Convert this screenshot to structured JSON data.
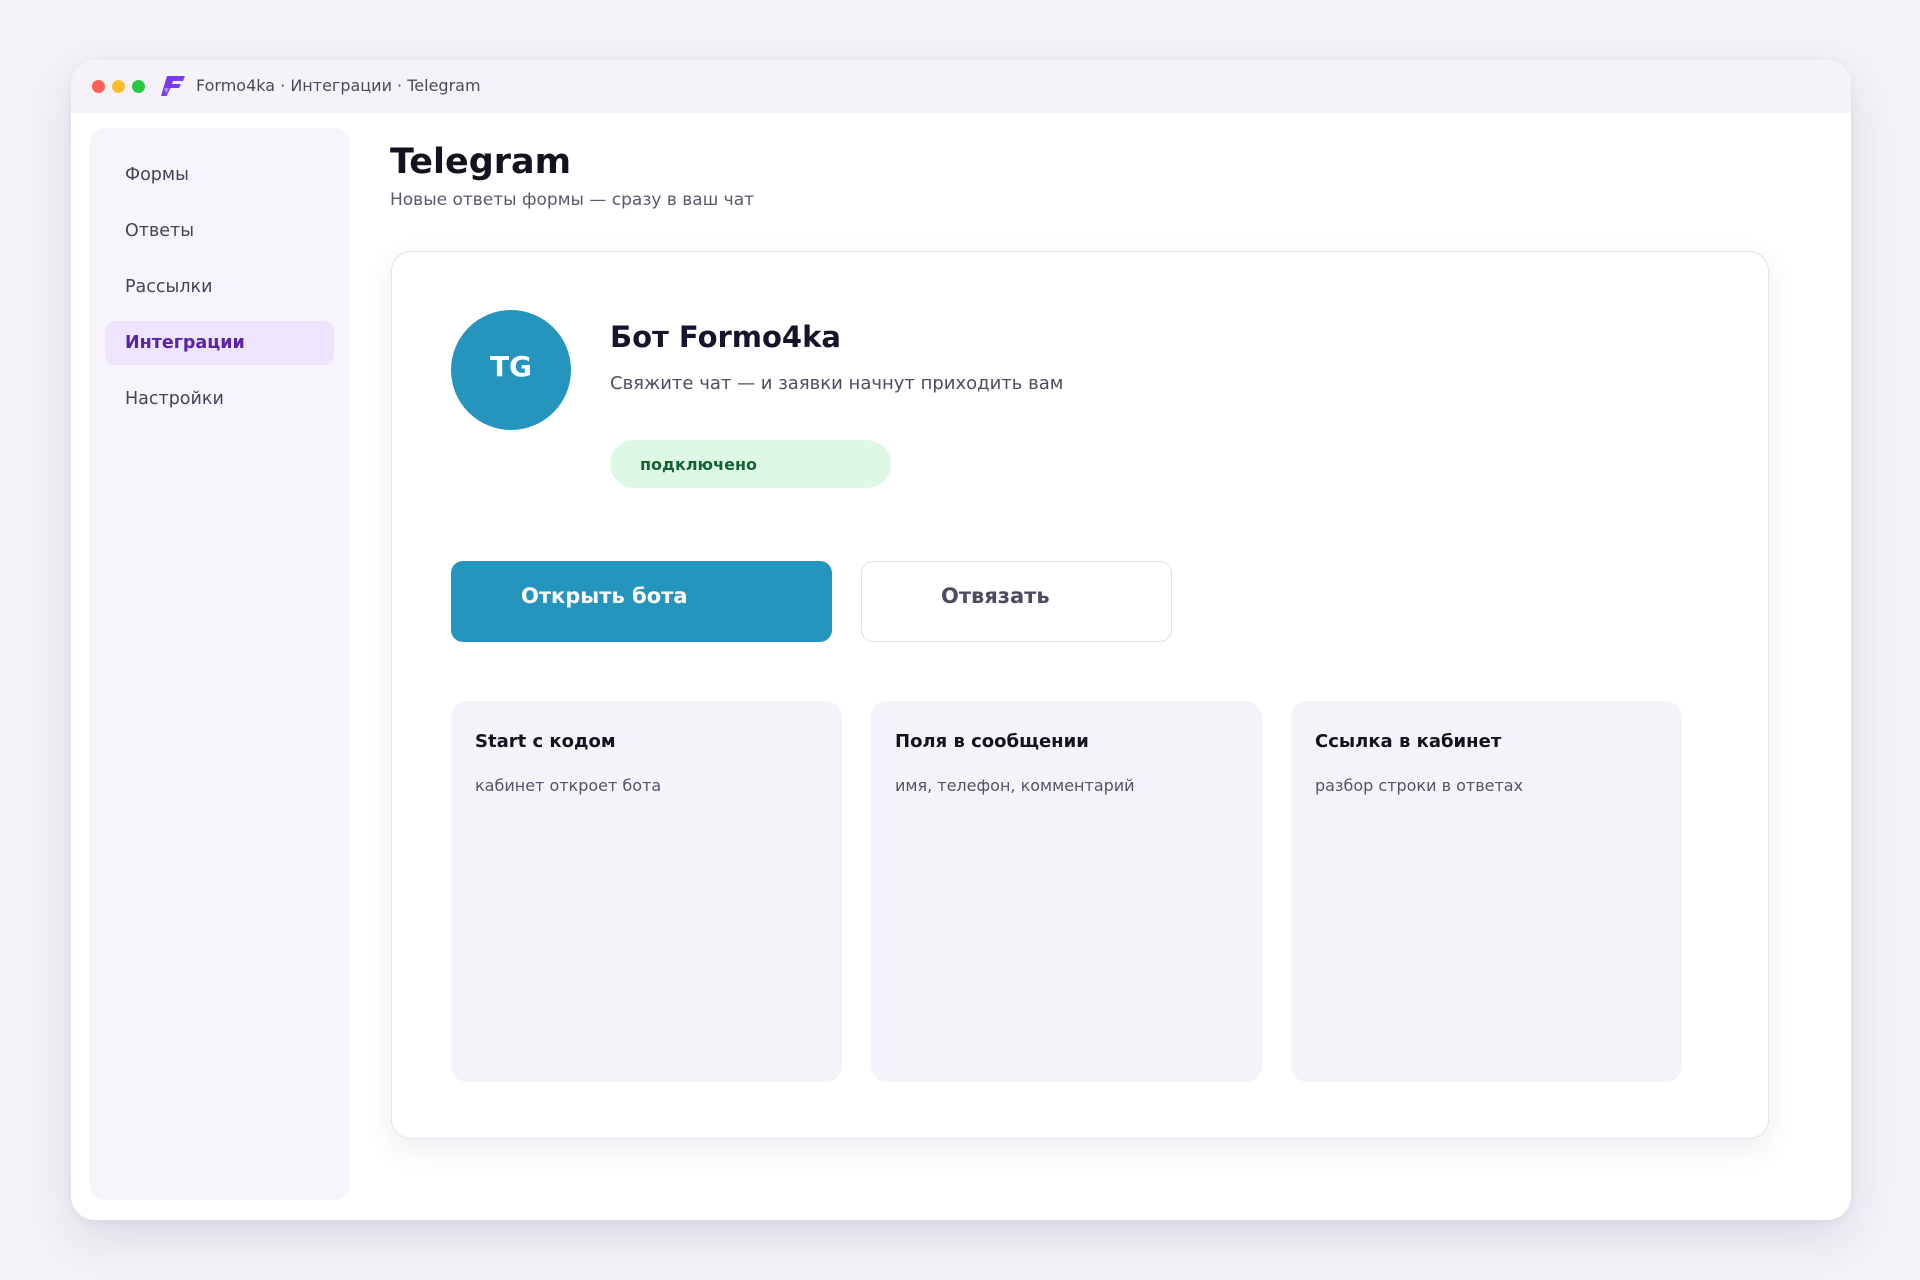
{
  "window": {
    "title": "Formo4ka · Интеграции · Telegram",
    "logo_icon": "formo4ka-logo-icon",
    "accent": "#7c3aed"
  },
  "sidebar": {
    "items": [
      {
        "label": "Формы",
        "active": false
      },
      {
        "label": "Ответы",
        "active": false
      },
      {
        "label": "Рассылки",
        "active": false
      },
      {
        "label": "Интеграции",
        "active": true
      },
      {
        "label": "Настройки",
        "active": false
      }
    ]
  },
  "page": {
    "title": "Telegram",
    "subtitle": "Новые ответы формы — сразу в ваш чат"
  },
  "bot": {
    "avatar_text": "TG",
    "name": "Бот Formo4ka",
    "description": "Свяжите чат — и заявки начнут приходить вам",
    "status": "подключено",
    "brand_color": "#2595be",
    "status_color": "#176233"
  },
  "actions": {
    "open_label": "Открыть бота",
    "unlink_label": "Отвязать"
  },
  "features": [
    {
      "title": "Start с кодом",
      "description": "кабинет откроет бота"
    },
    {
      "title": "Поля в сообщении",
      "description": "имя, телефон, комментарий"
    },
    {
      "title": "Ссылка в кабинет",
      "description": "разбор строки в ответах"
    }
  ]
}
